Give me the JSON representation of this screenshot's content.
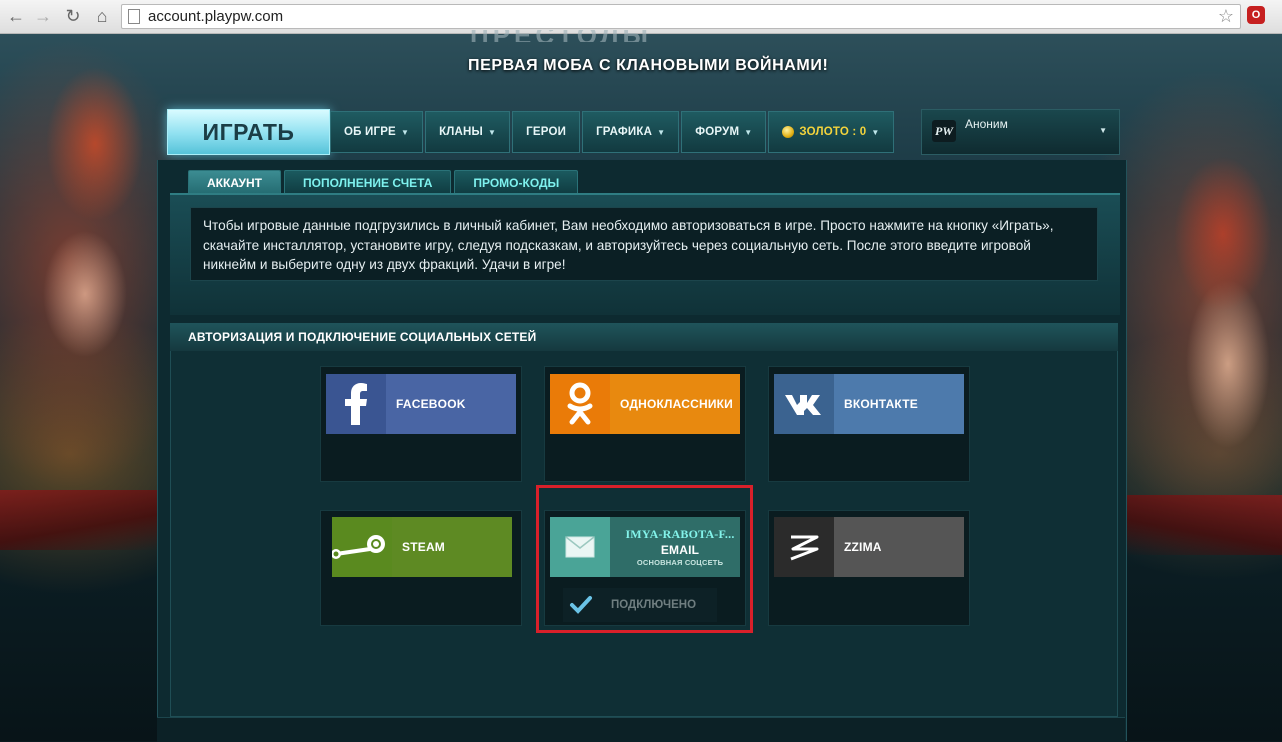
{
  "browser": {
    "url": "account.playpw.com"
  },
  "header": {
    "tagline": "ПЕРВАЯ МОБА С КЛАНОВЫМИ ВОЙНАМИ!"
  },
  "nav": {
    "play_label": "ИГРАТЬ",
    "items": [
      {
        "label": "ОБ ИГРЕ",
        "dropdown": true
      },
      {
        "label": "КЛАНЫ",
        "dropdown": true
      },
      {
        "label": "ГЕРОИ",
        "dropdown": false
      },
      {
        "label": "ГРАФИКА",
        "dropdown": true
      },
      {
        "label": "ФОРУМ",
        "dropdown": true
      }
    ],
    "gold_label": "ЗОЛОТО : 0",
    "user": {
      "logo_text": "PW",
      "name": "Аноним"
    }
  },
  "tabs": [
    {
      "label": "АККАУНТ",
      "active": true
    },
    {
      "label": "ПОПОЛНЕНИЕ СЧЕТА",
      "active": false
    },
    {
      "label": "ПРОМО-КОДЫ",
      "active": false
    }
  ],
  "info_text": "Чтобы игровые данные подгрузились в личный кабинет, Вам необходимо авторизоваться в игре. Просто нажмите на кнопку «Играть», скачайте инсталлятор, установите игру, следуя подсказкам, и авторизуйтесь через социальную сеть. После этого введите игровой никнейм и выберите одну из двух фракций. Удачи в игре!",
  "auth": {
    "title": "АВТОРИЗАЦИЯ И ПОДКЛЮЧЕНИЕ СОЦИАЛЬНЫХ СЕТЕЙ",
    "networks": {
      "facebook": "FACEBOOK",
      "odnoklassniki": "ОДНОКЛАССНИКИ",
      "vkontakte": "ВКОНТАКТЕ",
      "steam": "STEAM",
      "zzima": "ZZIMA"
    },
    "email": {
      "username": "IMYA-RABOTA-F...",
      "label": "EMAIL",
      "sub": "ОСНОВНАЯ СОЦСЕТЬ",
      "status": "ПОДКЛЮЧЕНО"
    }
  },
  "colors": {
    "play_button": "#8fe0f0",
    "tab_text": "#7ef1ee",
    "gold": "#f4d43c",
    "highlight": "#d8202a"
  }
}
